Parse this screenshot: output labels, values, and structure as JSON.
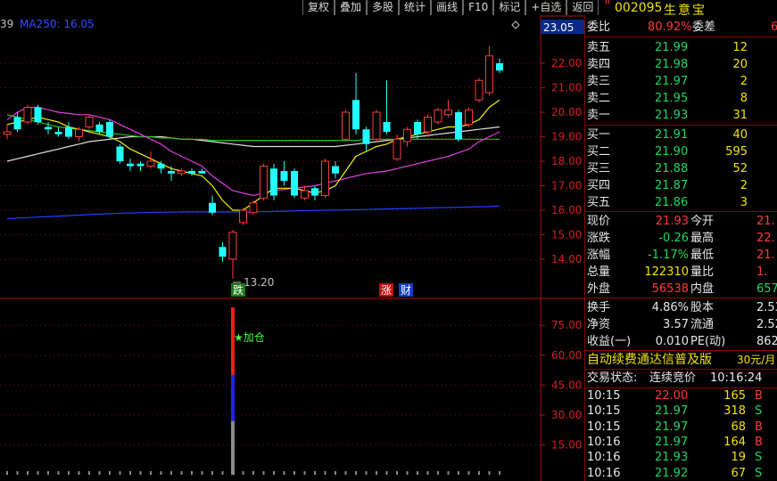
{
  "toolbar": [
    "复权",
    "叠加",
    "多股",
    "统计",
    "画线",
    "F10",
    "标记",
    "+自选",
    "返回"
  ],
  "stock": {
    "flag": "R",
    "code": "002095",
    "name": "生意宝"
  },
  "ma_label": {
    "prefix": "39",
    "text": "MA250: 16.05"
  },
  "price_axis": {
    "ticks": [
      "22.00",
      "21.00",
      "20.00",
      "19.00",
      "18.00",
      "17.00",
      "16.00",
      "15.00",
      "14.00"
    ],
    "highlight": "23.05"
  },
  "indicator_axis": {
    "ticks": [
      "75.00",
      "60.00",
      "45.00",
      "30.00",
      "15.00"
    ]
  },
  "annotations": {
    "low": "13.20",
    "buy_signal": "★加仓",
    "tag_down": "跌",
    "tag_up": "涨",
    "tag_fin": "财"
  },
  "colors": {
    "up": "#ff3a3a",
    "down": "#20ffff",
    "ma250": "#2040ff",
    "ma_white": "#e0e0e0",
    "ma_yellow": "#f0f000",
    "ma_magenta": "#e040e0",
    "ma_green": "#20c020"
  },
  "candles": [
    {
      "o": 19.1,
      "c": 19.2,
      "h": 19.5,
      "l": 18.9
    },
    {
      "o": 19.8,
      "c": 19.3,
      "h": 20.0,
      "l": 19.2
    },
    {
      "o": 19.6,
      "c": 20.2,
      "h": 20.3,
      "l": 19.5
    },
    {
      "o": 20.2,
      "c": 19.6,
      "h": 20.3,
      "l": 19.5
    },
    {
      "o": 19.4,
      "c": 19.3,
      "h": 19.6,
      "l": 19.1
    },
    {
      "o": 19.2,
      "c": 19.1,
      "h": 19.4,
      "l": 19.0
    },
    {
      "o": 19.4,
      "c": 19.0,
      "h": 19.6,
      "l": 18.9
    },
    {
      "o": 19.0,
      "c": 19.3,
      "h": 19.4,
      "l": 18.8
    },
    {
      "o": 19.4,
      "c": 19.8,
      "h": 19.9,
      "l": 19.3
    },
    {
      "o": 19.5,
      "c": 19.2,
      "h": 19.6,
      "l": 19.1
    },
    {
      "o": 19.6,
      "c": 19.0,
      "h": 19.7,
      "l": 18.9
    },
    {
      "o": 18.6,
      "c": 18.0,
      "h": 18.7,
      "l": 17.9
    },
    {
      "o": 17.9,
      "c": 17.8,
      "h": 18.1,
      "l": 17.6
    },
    {
      "o": 17.9,
      "c": 17.8,
      "h": 18.0,
      "l": 17.6
    },
    {
      "o": 17.8,
      "c": 18.0,
      "h": 18.4,
      "l": 17.7
    },
    {
      "o": 17.9,
      "c": 17.7,
      "h": 18.0,
      "l": 17.5
    },
    {
      "o": 17.6,
      "c": 17.5,
      "h": 17.8,
      "l": 17.2
    },
    {
      "o": 17.5,
      "c": 17.6,
      "h": 17.7,
      "l": 17.4
    },
    {
      "o": 17.6,
      "c": 17.5,
      "h": 17.7,
      "l": 17.4
    },
    {
      "o": 17.6,
      "c": 17.5,
      "h": 17.7,
      "l": 17.5
    },
    {
      "o": 16.3,
      "c": 15.9,
      "h": 16.6,
      "l": 15.8
    },
    {
      "o": 14.5,
      "c": 14.1,
      "h": 14.7,
      "l": 13.9
    },
    {
      "o": 14.0,
      "c": 15.1,
      "h": 15.2,
      "l": 13.2
    },
    {
      "o": 15.5,
      "c": 16.0,
      "h": 16.1,
      "l": 15.4
    },
    {
      "o": 15.9,
      "c": 16.3,
      "h": 16.4,
      "l": 15.8
    },
    {
      "o": 16.5,
      "c": 17.8,
      "h": 17.9,
      "l": 16.4
    },
    {
      "o": 17.7,
      "c": 16.6,
      "h": 17.9,
      "l": 16.4
    },
    {
      "o": 17.6,
      "c": 17.2,
      "h": 18.0,
      "l": 17.0
    },
    {
      "o": 17.6,
      "c": 16.6,
      "h": 17.7,
      "l": 16.5
    },
    {
      "o": 16.5,
      "c": 16.8,
      "h": 17.0,
      "l": 16.4
    },
    {
      "o": 16.9,
      "c": 16.6,
      "h": 17.0,
      "l": 16.4
    },
    {
      "o": 16.6,
      "c": 18.0,
      "h": 18.1,
      "l": 16.5
    },
    {
      "o": 17.8,
      "c": 17.5,
      "h": 18.0,
      "l": 17.3
    },
    {
      "o": 18.9,
      "c": 20.0,
      "h": 20.1,
      "l": 18.8
    },
    {
      "o": 20.5,
      "c": 19.3,
      "h": 21.6,
      "l": 19.1
    },
    {
      "o": 19.3,
      "c": 18.7,
      "h": 19.4,
      "l": 18.4
    },
    {
      "o": 18.9,
      "c": 20.0,
      "h": 20.1,
      "l": 18.8
    },
    {
      "o": 19.6,
      "c": 19.2,
      "h": 21.3,
      "l": 19.1
    },
    {
      "o": 18.1,
      "c": 18.9,
      "h": 19.1,
      "l": 18.0
    },
    {
      "o": 18.8,
      "c": 19.3,
      "h": 19.4,
      "l": 18.6
    },
    {
      "o": 19.6,
      "c": 19.1,
      "h": 19.7,
      "l": 18.9
    },
    {
      "o": 19.2,
      "c": 19.8,
      "h": 19.9,
      "l": 19.0
    },
    {
      "o": 19.6,
      "c": 20.1,
      "h": 20.2,
      "l": 19.5
    },
    {
      "o": 19.9,
      "c": 20.1,
      "h": 20.5,
      "l": 19.8
    },
    {
      "o": 20.0,
      "c": 18.9,
      "h": 20.1,
      "l": 18.8
    },
    {
      "o": 19.5,
      "c": 20.1,
      "h": 20.2,
      "l": 19.4
    },
    {
      "o": 20.5,
      "c": 21.3,
      "h": 21.4,
      "l": 20.4
    },
    {
      "o": 20.8,
      "c": 22.3,
      "h": 22.7,
      "l": 20.7
    },
    {
      "o": 22.0,
      "c": 21.7,
      "h": 22.2,
      "l": 21.6
    }
  ],
  "ma250": [
    15.65,
    15.68,
    15.7,
    15.72,
    15.74,
    15.76,
    15.78,
    15.8,
    15.82,
    15.84,
    15.86,
    15.88,
    15.89,
    15.9,
    15.91,
    15.92,
    15.92,
    15.93,
    15.93,
    15.93,
    15.93,
    15.93,
    15.93,
    15.93,
    15.94,
    15.94,
    15.95,
    15.96,
    15.97,
    15.98,
    15.99,
    16.0,
    16.0,
    16.01,
    16.02,
    16.03,
    16.04,
    16.05,
    16.06,
    16.07,
    16.08,
    16.09,
    16.1,
    16.11,
    16.12,
    16.13,
    16.14,
    16.15,
    16.17
  ],
  "ma_white": [
    18.0,
    18.1,
    18.2,
    18.3,
    18.4,
    18.5,
    18.6,
    18.7,
    18.8,
    18.85,
    18.9,
    18.95,
    19.0,
    19.0,
    19.0,
    19.0,
    18.95,
    18.9,
    18.9,
    18.85,
    18.8,
    18.75,
    18.7,
    18.65,
    18.6,
    18.6,
    18.6,
    18.6,
    18.6,
    18.6,
    18.6,
    18.6,
    18.6,
    18.65,
    18.7,
    18.75,
    18.8,
    18.85,
    18.9,
    18.95,
    19.0,
    19.05,
    19.1,
    19.15,
    19.2,
    19.25,
    19.3,
    19.35,
    19.4
  ],
  "ma_green": [
    19.9,
    19.8,
    19.7,
    19.6,
    19.5,
    19.4,
    19.35,
    19.3,
    19.25,
    19.2,
    19.15,
    19.1,
    19.05,
    19.0,
    19.0,
    18.95,
    18.95,
    18.9,
    18.9,
    18.9,
    18.85,
    18.85,
    18.85,
    18.85,
    18.85,
    18.85,
    18.85,
    18.85,
    18.85,
    18.85,
    18.85,
    18.85,
    18.85,
    18.85,
    18.85,
    18.9,
    18.9,
    18.9,
    18.9,
    18.9,
    18.9,
    18.9,
    18.9,
    18.9,
    18.9,
    18.9,
    18.9,
    18.9,
    18.9
  ],
  "ma_magenta": [
    19.7,
    20.0,
    20.2,
    20.2,
    20.1,
    20.0,
    19.95,
    19.9,
    19.9,
    19.8,
    19.7,
    19.5,
    19.3,
    19.1,
    18.9,
    18.7,
    18.4,
    18.2,
    18.0,
    17.8,
    17.4,
    17.1,
    16.8,
    16.7,
    16.6,
    16.7,
    16.8,
    16.85,
    16.9,
    16.95,
    17.0,
    17.1,
    17.2,
    17.3,
    17.4,
    17.5,
    17.55,
    17.6,
    17.7,
    17.8,
    17.9,
    18.0,
    18.1,
    18.2,
    18.35,
    18.5,
    18.8,
    19.0,
    19.2
  ],
  "ma_yellow": [
    19.5,
    19.6,
    19.7,
    19.8,
    19.7,
    19.6,
    19.4,
    19.3,
    19.2,
    19.1,
    19.0,
    18.8,
    18.5,
    18.3,
    18.1,
    17.9,
    17.7,
    17.6,
    17.5,
    17.4,
    17.0,
    16.4,
    16.0,
    16.0,
    16.3,
    16.6,
    16.9,
    16.9,
    16.9,
    16.8,
    16.7,
    16.8,
    17.0,
    17.6,
    18.2,
    18.4,
    18.6,
    18.7,
    18.9,
    19.0,
    19.1,
    19.2,
    19.3,
    19.4,
    19.4,
    19.5,
    19.7,
    20.2,
    20.5
  ],
  "signal": {
    "index": 22,
    "segments": [
      {
        "from": 0,
        "to": 27,
        "color": "#8a8a8a"
      },
      {
        "from": 27,
        "to": 50,
        "color": "#2020ff"
      },
      {
        "from": 50,
        "to": 84,
        "color": "#ff1a1a"
      }
    ]
  },
  "quote": {
    "weibi_label": "委比",
    "weibi_value": "80.92%",
    "weicha_label": "委差",
    "weicha_value": "6",
    "asks": [
      {
        "label": "卖五",
        "price": "21.99",
        "vol": "12"
      },
      {
        "label": "卖四",
        "price": "21.98",
        "vol": "20"
      },
      {
        "label": "卖三",
        "price": "21.97",
        "vol": "2"
      },
      {
        "label": "卖二",
        "price": "21.95",
        "vol": "8"
      },
      {
        "label": "卖一",
        "price": "21.93",
        "vol": "31"
      }
    ],
    "bids": [
      {
        "label": "买一",
        "price": "21.91",
        "vol": "40"
      },
      {
        "label": "买二",
        "price": "21.90",
        "vol": "595"
      },
      {
        "label": "买三",
        "price": "21.88",
        "vol": "52"
      },
      {
        "label": "买四",
        "price": "21.87",
        "vol": "2"
      },
      {
        "label": "买五",
        "price": "21.86",
        "vol": "3"
      }
    ],
    "stats": [
      {
        "l1": "现价",
        "v1": "21.93",
        "c1": "red",
        "l2": "今开",
        "v2": "21.",
        "c2": "red"
      },
      {
        "l1": "涨跌",
        "v1": "-0.26",
        "c1": "green",
        "l2": "最高",
        "v2": "22.",
        "c2": "red"
      },
      {
        "l1": "涨幅",
        "v1": "-1.17%",
        "c1": "green",
        "l2": "最低",
        "v2": "21.",
        "c2": "red"
      },
      {
        "l1": "总量",
        "v1": "122310",
        "c1": "yellow",
        "l2": "量比",
        "v2": "1.",
        "c2": "red"
      },
      {
        "l1": "外盘",
        "v1": "56538",
        "c1": "red",
        "l2": "内盘",
        "v2": "657",
        "c2": "green"
      }
    ],
    "fin": [
      {
        "l1": "换手",
        "v1": "4.86%",
        "l2": "股本",
        "v2": "2.53"
      },
      {
        "l1": "净资",
        "v1": "3.57",
        "l2": "流通",
        "v2": "2.52"
      },
      {
        "l1": "收益(一)",
        "v1": "0.010",
        "l2": "PE(动)",
        "v2": "862"
      }
    ],
    "promo": "自动续费通达信普及版",
    "promo_price": "30元/月",
    "trade_status_label": "交易状态:",
    "trade_status": "连续竞价",
    "trade_time": "10:16:24",
    "ticks": [
      {
        "time": "10:15",
        "price": "22.00",
        "vol": "165",
        "side": "B"
      },
      {
        "time": "10:15",
        "price": "21.97",
        "vol": "318",
        "side": "S"
      },
      {
        "time": "10:15",
        "price": "21.97",
        "vol": "68",
        "side": "B"
      },
      {
        "time": "10:16",
        "price": "21.97",
        "vol": "164",
        "side": "B"
      },
      {
        "time": "10:16",
        "price": "21.93",
        "vol": "19",
        "side": "S"
      },
      {
        "time": "10:16",
        "price": "21.92",
        "vol": "67",
        "side": "S"
      }
    ]
  }
}
